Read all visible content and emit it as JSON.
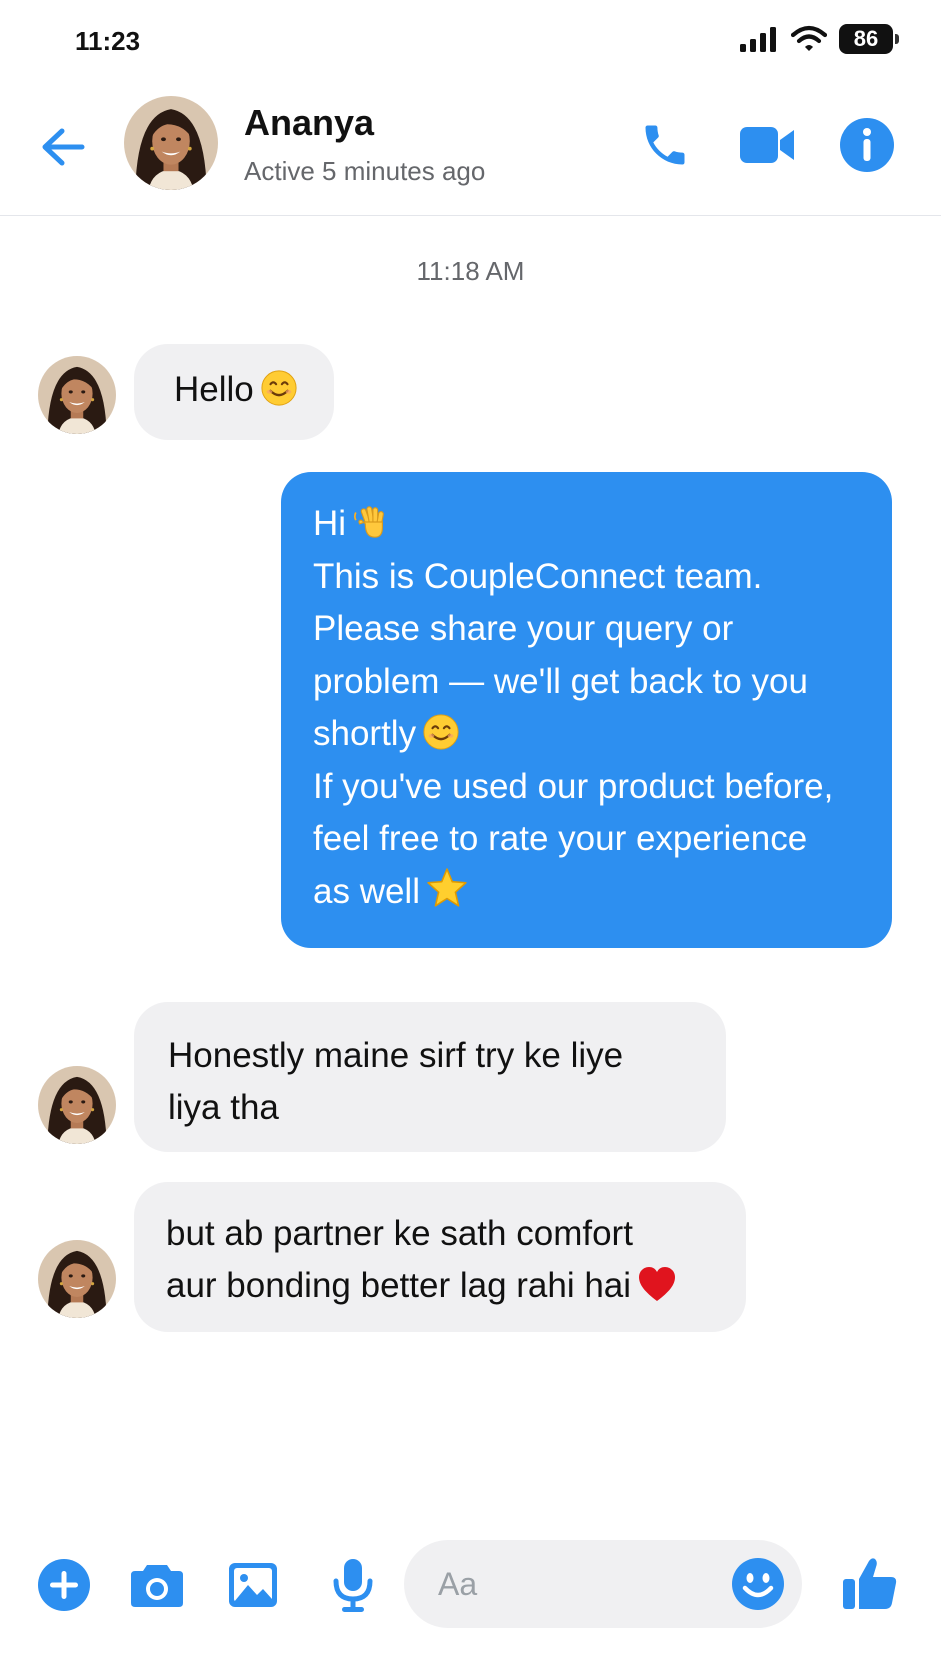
{
  "status_bar": {
    "time": "11:23",
    "battery": "86"
  },
  "header": {
    "name": "Ananya",
    "status": "Active 5 minutes ago"
  },
  "conversation": {
    "timestamp": "11:18 AM",
    "msg1": "Hello",
    "reply_lines": [
      "Hi",
      "This is CoupleConnect team.",
      "Please share your query or",
      "problem — we'll get back to you",
      "shortly",
      "If you've used our product before,",
      "feel free to rate your experience",
      "as well"
    ],
    "msg2_lines": [
      "Honestly maine sirf try ke liye",
      "liya tha"
    ],
    "msg3_lines": [
      "but ab partner ke sath comfort",
      "aur bonding better lag rahi hai"
    ]
  },
  "composer": {
    "placeholder": "Aa"
  },
  "colors": {
    "accent": "#2d8ff0",
    "incoming_bubble": "#f0f0f2",
    "muted_text": "#65676b"
  },
  "icons": [
    "back-arrow-icon",
    "phone-icon",
    "video-camera-icon",
    "info-icon",
    "plus-icon",
    "camera-icon",
    "image-icon",
    "microphone-icon",
    "emoji-icon",
    "thumbs-up-icon",
    "smile-emoji",
    "wave-emoji",
    "star-emoji",
    "heart-emoji"
  ]
}
